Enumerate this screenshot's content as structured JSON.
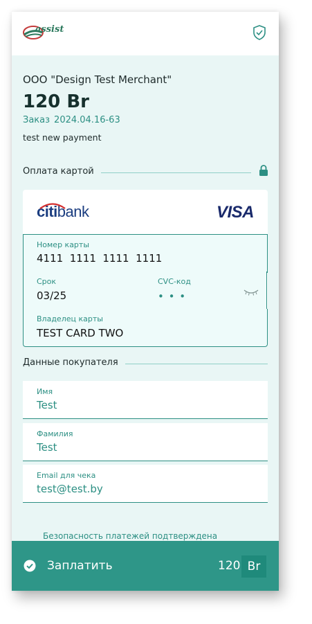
{
  "header": {
    "logo_text": "assist"
  },
  "merchant": {
    "name": "ООО \"Design Test Merchant\"",
    "amount": "120 Br",
    "order_label": "Заказ",
    "order_number": "2024.04.16-63",
    "description": "test new payment"
  },
  "card_section": {
    "title": "Оплата картой",
    "bank": {
      "part1": "citi",
      "part2": "bank"
    },
    "brand": "VISA",
    "number_label": "Номер карты",
    "number_value": "4111  1111  1111  1111",
    "expiry_label": "Срок",
    "expiry_value": "03/25",
    "cvc_label": "CVC-код",
    "cvc_value": "• • •",
    "holder_label": "Владелец карты",
    "holder_value": "TEST CARD TWO"
  },
  "buyer_section": {
    "title": "Данные покупателя",
    "fields": [
      {
        "label": "Имя",
        "value": "Test"
      },
      {
        "label": "Фамилия",
        "value": "Test"
      },
      {
        "label": "Email для чека",
        "value": "test@test.by"
      }
    ]
  },
  "security_note": "Безопасность платежей подтверждена",
  "pay_bar": {
    "label": "Заплатить",
    "amount": "120",
    "currency": "Br"
  },
  "colors": {
    "accent": "#2e9688",
    "accent_text": "#2c8f83",
    "background": "#e9f6f5"
  }
}
